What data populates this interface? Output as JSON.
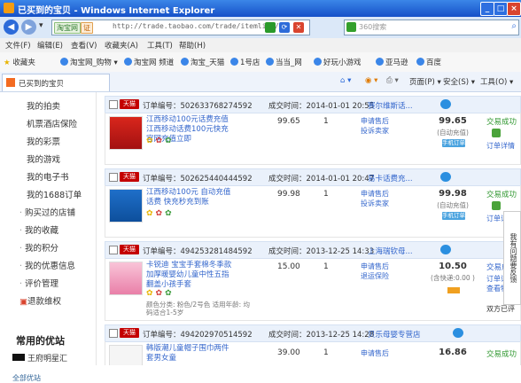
{
  "window": {
    "title": "已买到的宝贝 - Windows Internet Explorer",
    "min": "_",
    "max": "□",
    "close": "×"
  },
  "address": {
    "tag1": "淘宝网",
    "tag2": "证",
    "url": "http://trade.taobao.com/trade/itemlist/",
    "search_placeholder": "360搜索",
    "back": "◀",
    "forward": "▶",
    "dropdown": "▾",
    "go_icon": "⟳",
    "stop_icon": "✕",
    "search_icon": "⌕"
  },
  "menu": [
    "文件(F)",
    "编辑(E)",
    "查看(V)",
    "收藏夹(A)",
    "工具(T)",
    "帮助(H)"
  ],
  "favorites": [
    "收藏夹",
    "淘宝网_购物 ▾",
    "淘宝网 频道",
    "淘宝_天猫",
    "1号店",
    "当当_网",
    "好玩小游戏",
    "亚马逊",
    "百度"
  ],
  "tab": {
    "label": "已买到的宝贝"
  },
  "tab_tools": [
    "页面(P) ▾",
    "安全(S) ▾",
    "工具(O) ▾"
  ],
  "sidebar": {
    "items": [
      "我的拍卖",
      "机票酒店保险",
      "我的彩票",
      "我的游戏",
      "我的电子书",
      "我的1688订单",
      "购买过的店铺",
      "我的收藏",
      "我的积分",
      "我的优惠信息",
      "评价管理",
      "退款维权"
    ],
    "section_title": "常用的优站",
    "brand": "王府明星汇",
    "all_link": "全部优站"
  },
  "orders": [
    {
      "tmall": "天猫",
      "order_no": "订单编号：502633768274592",
      "time": "成交时间：2014-01-01 20:55",
      "shop": "赛尔维斯话...",
      "product": "江西移动100元话费充值 江西移动话费100元快充 官网充值立即",
      "spec": "",
      "price": "99.65",
      "qty": "1",
      "aftersale1": "申请售后",
      "aftersale2": "投诉卖家",
      "total": "99.65",
      "total_note": "(自动充值)",
      "phone_btn": "手机订单",
      "status": "交易成功",
      "status_link": "订单详情",
      "status_extra": ""
    },
    {
      "tmall": "天猫",
      "order_no": "订单编号：502625440444592",
      "time": "成交时间：2014-01-01 20:47",
      "shop": "易卡话费充...",
      "product": "江西移动100元 自动充值话费 快充秒充到账",
      "spec": "",
      "price": "99.98",
      "qty": "1",
      "aftersale1": "申请售后",
      "aftersale2": "投诉卖家",
      "total": "99.98",
      "total_note": "(自动充值)",
      "phone_btn": "手机订单",
      "status": "交易成功",
      "status_link": "订单详情",
      "status_extra": ""
    },
    {
      "tmall": "天猫",
      "order_no": "订单编号：494253281484592",
      "time": "成交时间：2013-12-25 14:33",
      "shop": "上海瑞钦母...",
      "product": "卡锐迪 宝宝手套棉冬季款加厚暖婴幼儿童中性五指翻盖小孩手套",
      "spec": "颜色分类: 粉色/2号色 适用年龄: 均码适合1-5岁",
      "price": "15.00",
      "qty": "1",
      "aftersale1": "申请售后",
      "aftersale2": "退运保险",
      "total": "10.50",
      "total_note": "(含快递:0.00 )",
      "phone_btn": "",
      "status": "交易成功",
      "status_link": "订单详情 查看物流",
      "status_extra": "双方已评"
    },
    {
      "tmall": "天猫",
      "order_no": "订单编号：494202970514592",
      "time": "成交时间：2013-12-25 14:28",
      "shop": "贝乐母婴专营店",
      "product": "韩版潮儿童帽子围巾两件套男女童",
      "spec": "",
      "price": "39.00",
      "qty": "1",
      "aftersale1": "申请售后",
      "aftersale2": "",
      "total": "16.86",
      "total_note": "",
      "phone_btn": "",
      "status": "交易成功",
      "status_link": "",
      "status_extra": ""
    }
  ],
  "feedback": "我有问题要反馈",
  "colors": {
    "tmall_red": "#c40000",
    "link_blue": "#3366cc",
    "title_blue": "#1550c8"
  }
}
